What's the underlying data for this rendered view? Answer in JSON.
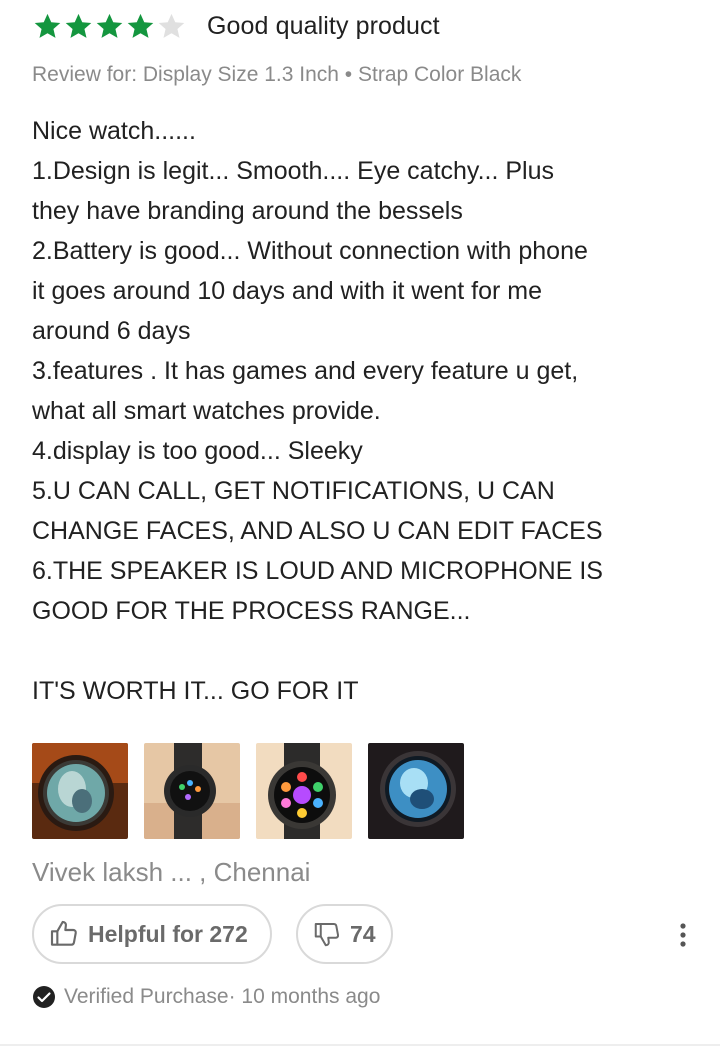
{
  "review": {
    "rating": 4,
    "rating_max": 5,
    "title": "Good quality product",
    "variant": "Review for: Display Size 1.3 Inch • Strap Color Black",
    "body_lines": [
      "Nice watch......",
      "1.Design is legit... Smooth.... Eye catchy... Plus",
      "they have branding around the bessels",
      "2.Battery is good... Without connection with phone",
      "it goes around 10 days and with it went for me",
      "around 6 days",
      "3.features . It has games and every feature u get,",
      "what all smart watches provide.",
      "4.display is too good... Sleeky",
      "5.U CAN CALL, GET NOTIFICATIONS, U CAN",
      "CHANGE FACES, AND ALSO U CAN EDIT FACES",
      "6.THE SPEAKER IS LOUD AND MICROPHONE IS",
      "GOOD FOR THE PROCESS RANGE...",
      "",
      "IT'S WORTH IT... GO FOR IT"
    ],
    "photos": [
      {
        "icon": "watch-photo-face-anime"
      },
      {
        "icon": "watch-photo-wrist-dark"
      },
      {
        "icon": "watch-photo-app-menu"
      },
      {
        "icon": "watch-photo-face-blue"
      }
    ],
    "reviewer": "Vivek laksh ... , Chennai",
    "helpful_label": "Helpful for 272",
    "unhelpful_count": "74",
    "verified_label": "Verified Purchase",
    "time_ago": "· 10 months ago"
  },
  "colors": {
    "star_filled": "#14963f",
    "star_empty": "#e0e0e0",
    "muted_text": "#8a8a8a",
    "body_text": "#212121",
    "button_border": "#d9d9d9"
  }
}
